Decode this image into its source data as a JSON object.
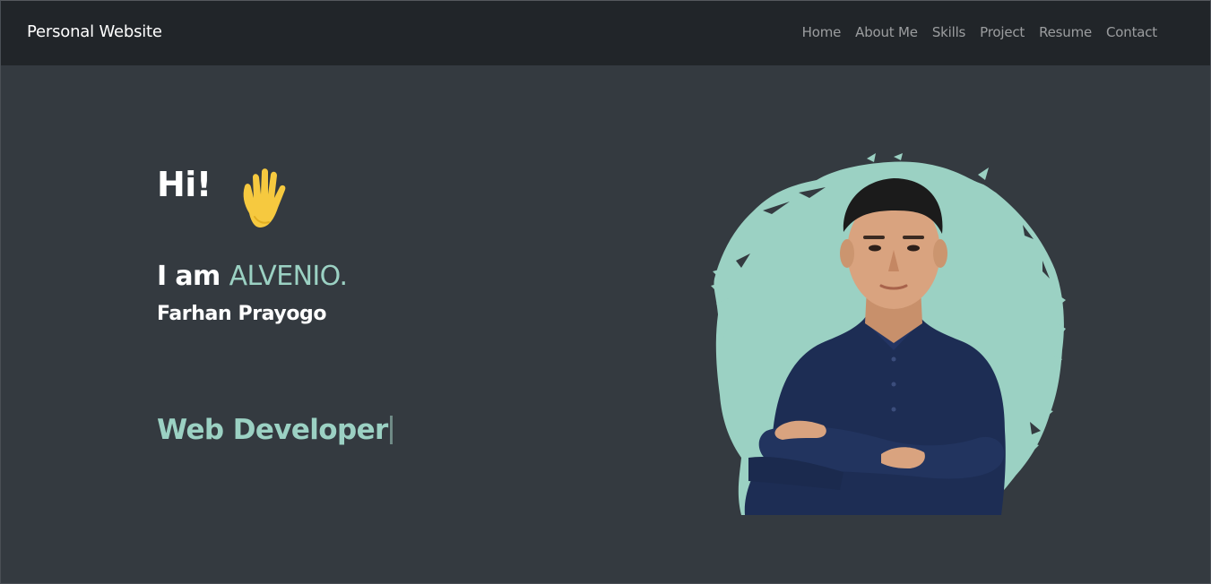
{
  "navbar": {
    "brand": "Personal Website",
    "links": [
      "Home",
      "About Me",
      "Skills",
      "Project",
      "Resume",
      "Contact"
    ]
  },
  "hero": {
    "greeting": "Hi!",
    "wave_icon": "waving-hand-icon",
    "intro_prefix": "I am ",
    "intro_name": "ALVENIO.",
    "full_name": "Farhan Prayogo",
    "role": "Web Developer"
  },
  "colors": {
    "navbar_bg": "#212529",
    "page_bg": "#343a40",
    "accent": "#9bd1c3",
    "wave": "#f6c93f"
  }
}
